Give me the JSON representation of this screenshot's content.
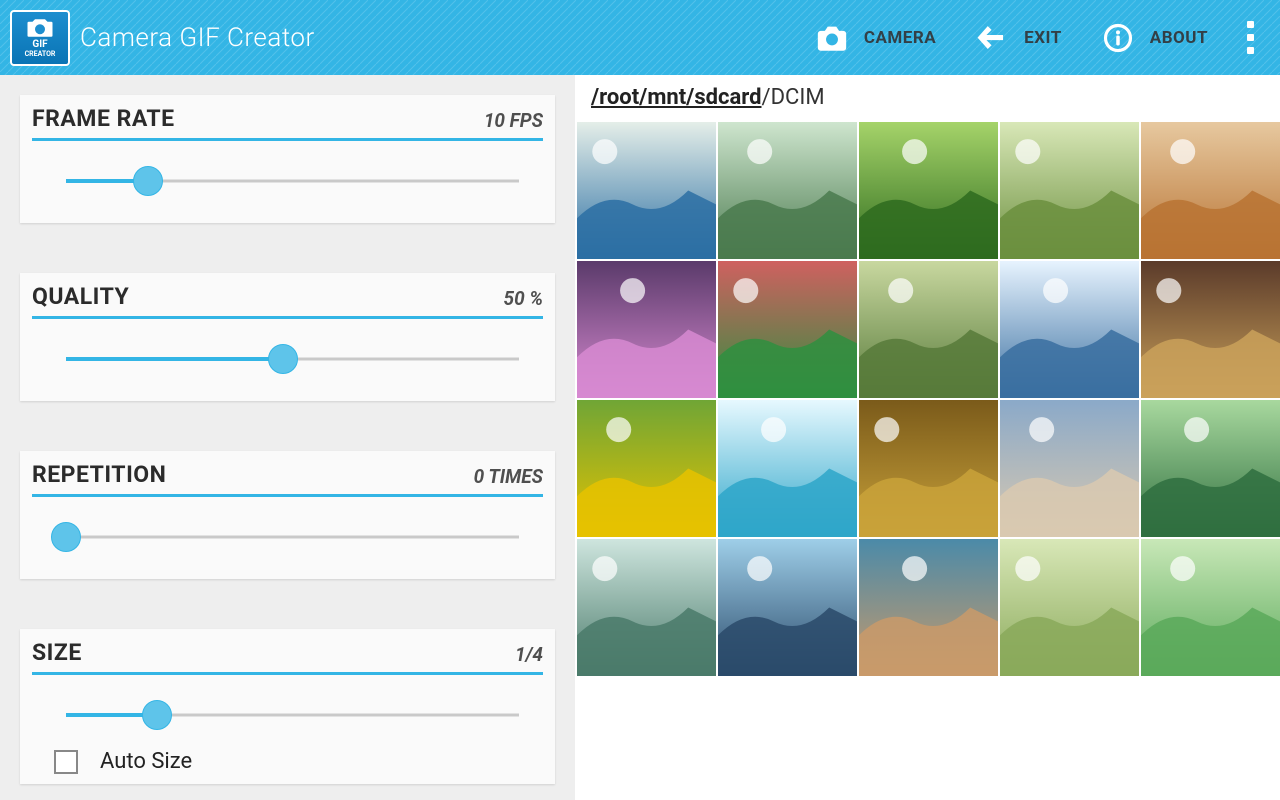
{
  "app": {
    "title": "Camera GIF Creator",
    "icon_label": "GIF",
    "icon_sub": "CREATOR"
  },
  "actionbar": {
    "camera": "CAMERA",
    "exit": "EXIT",
    "about": "ABOUT"
  },
  "settings": {
    "framerate": {
      "title": "FRAME RATE",
      "value": "10 FPS",
      "percent": 18
    },
    "quality": {
      "title": "QUALITY",
      "value": "50 %",
      "percent": 48
    },
    "repetition": {
      "title": "REPETITION",
      "value": "0 TIMES",
      "percent": 0
    },
    "size": {
      "title": "SIZE",
      "value": "1/4",
      "percent": 20,
      "auto_label": "Auto Size",
      "auto_checked": false
    }
  },
  "browser": {
    "path_linked": "/root/mnt/sdcard",
    "path_tail": "/DCIM",
    "thumb_count": 20,
    "thumbs": [
      "cliff-kayaks",
      "waterfall-stream",
      "green-leaves",
      "cycling-path",
      "canyon-river",
      "pink-sunset-tree",
      "formal-garden",
      "park-statue",
      "mountain-lake",
      "valley-sunset",
      "sunflower-field",
      "tropical-island",
      "autumn-forest",
      "laughing-child",
      "heart-cloud-forest",
      "big-waterfall",
      "bonsai-island",
      "beach-cove",
      "gardener-man",
      "succulent-closeup"
    ]
  },
  "colors": {
    "accent": "#33b5e5"
  }
}
